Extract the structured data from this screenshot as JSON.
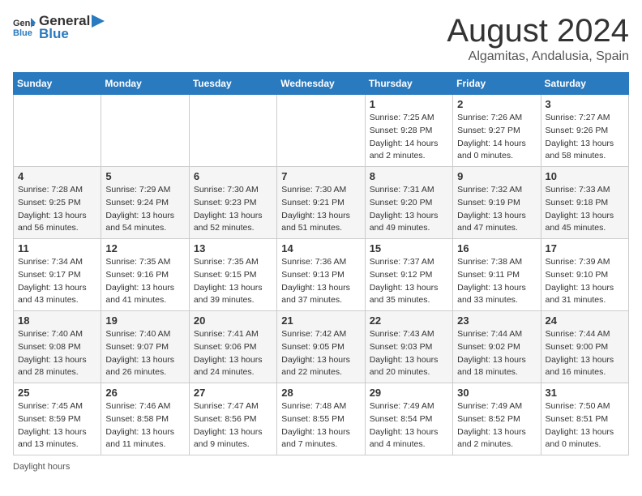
{
  "header": {
    "logo_general": "General",
    "logo_blue": "Blue",
    "title": "August 2024",
    "location": "Algamitas, Andalusia, Spain"
  },
  "calendar": {
    "days_of_week": [
      "Sunday",
      "Monday",
      "Tuesday",
      "Wednesday",
      "Thursday",
      "Friday",
      "Saturday"
    ],
    "weeks": [
      [
        {
          "day": "",
          "info": ""
        },
        {
          "day": "",
          "info": ""
        },
        {
          "day": "",
          "info": ""
        },
        {
          "day": "",
          "info": ""
        },
        {
          "day": "1",
          "info": "Sunrise: 7:25 AM\nSunset: 9:28 PM\nDaylight: 14 hours\nand 2 minutes."
        },
        {
          "day": "2",
          "info": "Sunrise: 7:26 AM\nSunset: 9:27 PM\nDaylight: 14 hours\nand 0 minutes."
        },
        {
          "day": "3",
          "info": "Sunrise: 7:27 AM\nSunset: 9:26 PM\nDaylight: 13 hours\nand 58 minutes."
        }
      ],
      [
        {
          "day": "4",
          "info": "Sunrise: 7:28 AM\nSunset: 9:25 PM\nDaylight: 13 hours\nand 56 minutes."
        },
        {
          "day": "5",
          "info": "Sunrise: 7:29 AM\nSunset: 9:24 PM\nDaylight: 13 hours\nand 54 minutes."
        },
        {
          "day": "6",
          "info": "Sunrise: 7:30 AM\nSunset: 9:23 PM\nDaylight: 13 hours\nand 52 minutes."
        },
        {
          "day": "7",
          "info": "Sunrise: 7:30 AM\nSunset: 9:21 PM\nDaylight: 13 hours\nand 51 minutes."
        },
        {
          "day": "8",
          "info": "Sunrise: 7:31 AM\nSunset: 9:20 PM\nDaylight: 13 hours\nand 49 minutes."
        },
        {
          "day": "9",
          "info": "Sunrise: 7:32 AM\nSunset: 9:19 PM\nDaylight: 13 hours\nand 47 minutes."
        },
        {
          "day": "10",
          "info": "Sunrise: 7:33 AM\nSunset: 9:18 PM\nDaylight: 13 hours\nand 45 minutes."
        }
      ],
      [
        {
          "day": "11",
          "info": "Sunrise: 7:34 AM\nSunset: 9:17 PM\nDaylight: 13 hours\nand 43 minutes."
        },
        {
          "day": "12",
          "info": "Sunrise: 7:35 AM\nSunset: 9:16 PM\nDaylight: 13 hours\nand 41 minutes."
        },
        {
          "day": "13",
          "info": "Sunrise: 7:35 AM\nSunset: 9:15 PM\nDaylight: 13 hours\nand 39 minutes."
        },
        {
          "day": "14",
          "info": "Sunrise: 7:36 AM\nSunset: 9:13 PM\nDaylight: 13 hours\nand 37 minutes."
        },
        {
          "day": "15",
          "info": "Sunrise: 7:37 AM\nSunset: 9:12 PM\nDaylight: 13 hours\nand 35 minutes."
        },
        {
          "day": "16",
          "info": "Sunrise: 7:38 AM\nSunset: 9:11 PM\nDaylight: 13 hours\nand 33 minutes."
        },
        {
          "day": "17",
          "info": "Sunrise: 7:39 AM\nSunset: 9:10 PM\nDaylight: 13 hours\nand 31 minutes."
        }
      ],
      [
        {
          "day": "18",
          "info": "Sunrise: 7:40 AM\nSunset: 9:08 PM\nDaylight: 13 hours\nand 28 minutes."
        },
        {
          "day": "19",
          "info": "Sunrise: 7:40 AM\nSunset: 9:07 PM\nDaylight: 13 hours\nand 26 minutes."
        },
        {
          "day": "20",
          "info": "Sunrise: 7:41 AM\nSunset: 9:06 PM\nDaylight: 13 hours\nand 24 minutes."
        },
        {
          "day": "21",
          "info": "Sunrise: 7:42 AM\nSunset: 9:05 PM\nDaylight: 13 hours\nand 22 minutes."
        },
        {
          "day": "22",
          "info": "Sunrise: 7:43 AM\nSunset: 9:03 PM\nDaylight: 13 hours\nand 20 minutes."
        },
        {
          "day": "23",
          "info": "Sunrise: 7:44 AM\nSunset: 9:02 PM\nDaylight: 13 hours\nand 18 minutes."
        },
        {
          "day": "24",
          "info": "Sunrise: 7:44 AM\nSunset: 9:00 PM\nDaylight: 13 hours\nand 16 minutes."
        }
      ],
      [
        {
          "day": "25",
          "info": "Sunrise: 7:45 AM\nSunset: 8:59 PM\nDaylight: 13 hours\nand 13 minutes."
        },
        {
          "day": "26",
          "info": "Sunrise: 7:46 AM\nSunset: 8:58 PM\nDaylight: 13 hours\nand 11 minutes."
        },
        {
          "day": "27",
          "info": "Sunrise: 7:47 AM\nSunset: 8:56 PM\nDaylight: 13 hours\nand 9 minutes."
        },
        {
          "day": "28",
          "info": "Sunrise: 7:48 AM\nSunset: 8:55 PM\nDaylight: 13 hours\nand 7 minutes."
        },
        {
          "day": "29",
          "info": "Sunrise: 7:49 AM\nSunset: 8:54 PM\nDaylight: 13 hours\nand 4 minutes."
        },
        {
          "day": "30",
          "info": "Sunrise: 7:49 AM\nSunset: 8:52 PM\nDaylight: 13 hours\nand 2 minutes."
        },
        {
          "day": "31",
          "info": "Sunrise: 7:50 AM\nSunset: 8:51 PM\nDaylight: 13 hours\nand 0 minutes."
        }
      ]
    ]
  },
  "footer": {
    "note": "Daylight hours"
  }
}
